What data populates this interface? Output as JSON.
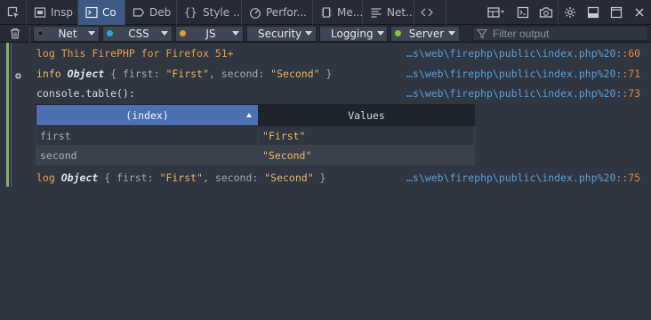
{
  "toolbar": {
    "tabs": [
      {
        "label": "Insp",
        "icon": "inspector-icon"
      },
      {
        "label": "Co",
        "icon": "console-icon",
        "selected": true
      },
      {
        "label": "Deb",
        "icon": "debugger-icon"
      },
      {
        "label": "Style ...",
        "icon": "style-editor-icon"
      },
      {
        "label": "Perfor...",
        "icon": "performance-icon"
      },
      {
        "label": "Me...",
        "icon": "memory-icon"
      },
      {
        "label": "Net...",
        "icon": "network-icon"
      }
    ]
  },
  "filters": {
    "buttons": [
      {
        "label": "Net",
        "dot": "#1b1e24"
      },
      {
        "label": "CSS",
        "dot": "#2fa3dd"
      },
      {
        "label": "JS",
        "dot": "#e89c26"
      },
      {
        "label": "Security",
        "dot": "#e8393d"
      },
      {
        "label": "Logging",
        "dot": "#b1b5bc"
      },
      {
        "label": "Server",
        "dot": "#8bc34a"
      }
    ],
    "search_placeholder": "Filter output"
  },
  "console": {
    "messages": [
      {
        "prefix": "log",
        "text": "This FirePHP for Firefox 51+",
        "source": "…s\\web\\firephp\\public\\index.php%20:",
        "line": ":60"
      },
      {
        "prefix": "info",
        "object": "Object",
        "props_a": "{ first: ",
        "val_a": "\"First\"",
        "props_b": ", second: ",
        "val_b": "\"Second\"",
        "close": " }",
        "source": "…s\\web\\firephp\\public\\index.php%20:",
        "line": ":71"
      },
      {
        "call": "console.table():",
        "source": "…s\\web\\firephp\\public\\index.php%20:",
        "line": ":73"
      },
      {
        "prefix": "log",
        "object": "Object",
        "props_a": "{ first: ",
        "val_a": "\"First\"",
        "props_b": ", second: ",
        "val_b": "\"Second\"",
        "close": " }",
        "source": "…s\\web\\firephp\\public\\index.php%20:",
        "line": ":75"
      }
    ],
    "table": {
      "columns": [
        "(index)",
        "Values"
      ],
      "rows": [
        {
          "index": "first",
          "value": "\"First\""
        },
        {
          "index": "second",
          "value": "\"Second\""
        }
      ]
    }
  },
  "colors": {
    "accent": "#3c5a85",
    "table_header": "#4d70b2",
    "source_link": "#5ea1d8",
    "line_number": "#e8853d",
    "string": "#ecb85b"
  }
}
